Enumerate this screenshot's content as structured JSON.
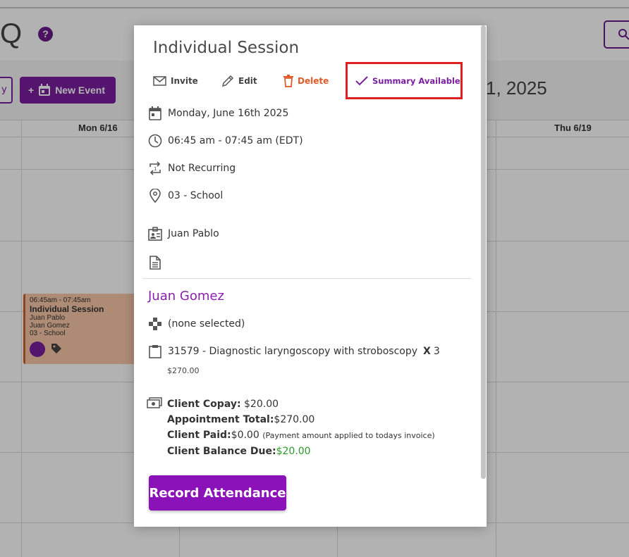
{
  "background": {
    "logo_letter": "Q",
    "help_icon": "?",
    "left_button_label": "y",
    "new_event_label": "New Event",
    "new_event_plus": "+",
    "date_title": "1, 2025",
    "columns": [
      "Mon 6/16",
      "Thu 6/19"
    ],
    "event": {
      "time": "06:45am - 07:45am",
      "title": "Individual Session",
      "line1": "Juan Pablo",
      "line2": "Juan Gomez",
      "line3": "03 - School"
    }
  },
  "modal": {
    "title": "Individual Session",
    "actions": {
      "invite": "Invite",
      "edit": "Edit",
      "delete": "Delete",
      "summary": "Summary Available"
    },
    "details": {
      "date": "Monday, June 16th 2025",
      "time": "06:45 am - 07:45 am (EDT)",
      "recurrence": "Not Recurring",
      "location": "03 - School",
      "provider": "Juan Pablo"
    },
    "client": {
      "name": "Juan Gomez",
      "program": "(none selected)",
      "service_code": "31579 - Diagnostic laryngoscopy with stroboscopy",
      "quantity_marker": "X",
      "quantity": "3",
      "service_price": "$270.00"
    },
    "billing": {
      "copay_label": "Client Copay:",
      "copay_value": "$20.00",
      "total_label": "Appointment Total:",
      "total_value": "$270.00",
      "paid_label": "Client Paid:",
      "paid_value": "$0.00",
      "paid_note": "(Payment amount applied to todays invoice)",
      "balance_label": "Client Balance Due:",
      "balance_value": "$20.00"
    },
    "record_button": "Record Attendance"
  },
  "colors": {
    "accent": "#8a12b8",
    "delete": "#e05a2a",
    "highlight": "#e02020",
    "balance": "#2a9a2a"
  },
  "icons": [
    "envelope-icon",
    "pencil-icon",
    "trash-icon",
    "checkmark-icon",
    "calendar-icon",
    "clock-icon",
    "repeat-icon",
    "location-pin-icon",
    "id-card-icon",
    "document-icon",
    "gamepad-icon",
    "clipboard-icon",
    "money-icon"
  ]
}
